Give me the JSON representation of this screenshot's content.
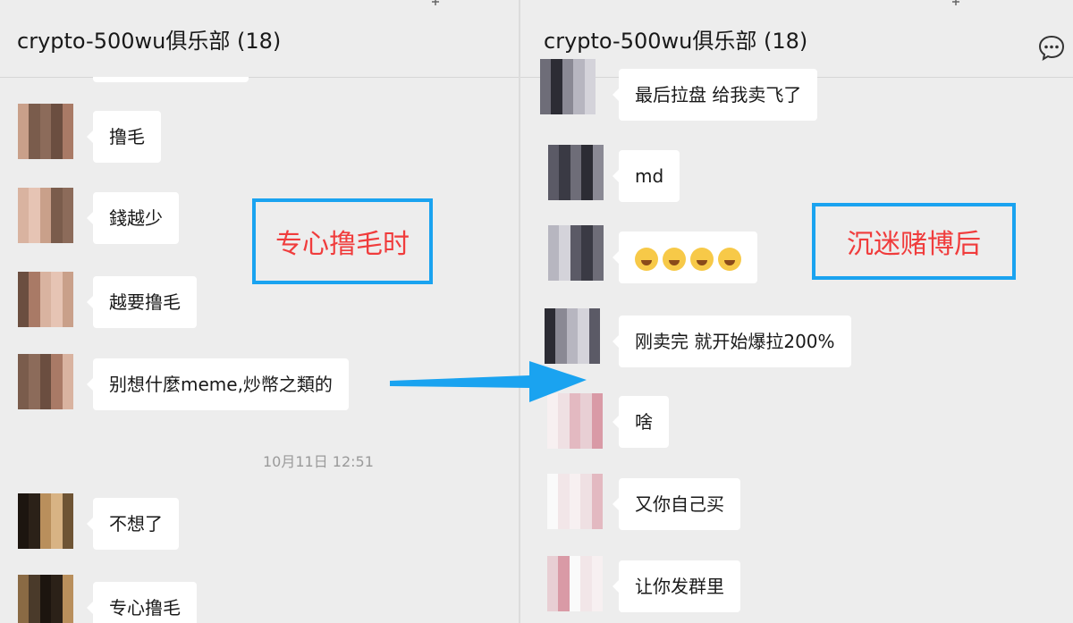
{
  "left": {
    "title": "crypto-500wu俱乐部 (18)",
    "messages": [
      {
        "text": "撸毛"
      },
      {
        "text": "錢越少"
      },
      {
        "text": "越要撸毛"
      },
      {
        "text": "别想什麼meme,炒幣之類的"
      },
      {
        "text": "不想了"
      },
      {
        "text": "专心撸毛"
      }
    ],
    "timestamp": "10月11日 12:51",
    "note": "专心撸毛时"
  },
  "right": {
    "title": "crypto-500wu俱乐部 (18)",
    "messages": [
      {
        "text": "最后拉盘 给我卖飞了"
      },
      {
        "text": "md"
      },
      {
        "text": "",
        "emoji": [
          "crying-laughing-emoji",
          "crying-laughing-emoji",
          "crying-laughing-emoji",
          "crying-laughing-emoji"
        ]
      },
      {
        "text": "刚卖完 就开始爆拉200%"
      },
      {
        "text": "啥"
      },
      {
        "text": "又你自己买"
      },
      {
        "text": "让你发群里"
      }
    ],
    "note": "沉迷赌博后"
  },
  "colors": {
    "annotation_border": "#1aa3f0",
    "annotation_text": "#f03c3c",
    "arrow": "#1aa3f0",
    "bubble": "#ffffff",
    "background": "#ededed"
  }
}
